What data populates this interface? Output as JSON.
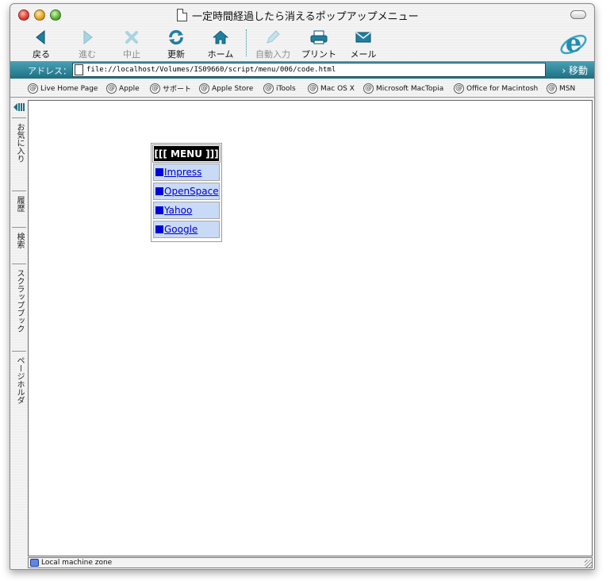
{
  "window": {
    "title": "一定時間経過したら消えるポップアップメニュー"
  },
  "toolbar": {
    "back": "戻る",
    "forward": "進む",
    "stop": "中止",
    "refresh": "更新",
    "home": "ホーム",
    "autofill": "自動入力",
    "print": "プリント",
    "mail": "メール"
  },
  "address": {
    "label": "アドレス：",
    "url": "file://localhost/Volumes/IS09660/script/menu/006/code.html",
    "go": "移動"
  },
  "favorites": [
    "Live Home Page",
    "Apple",
    "サポート",
    "Apple Store",
    "iTools",
    "Mac OS X",
    "Microsoft MacTopia",
    "Office for Macintosh",
    "MSN"
  ],
  "sidebar": {
    "tabs": [
      "お気に入り",
      "履歴",
      "検索",
      "スクラップブック",
      "ページホルダ"
    ]
  },
  "menu": {
    "header": "[[[ MENU ]]]",
    "items": [
      {
        "bullet": "■",
        "label": "Impress"
      },
      {
        "bullet": "■",
        "label": "OpenSpace"
      },
      {
        "bullet": "■",
        "label": "Yahoo"
      },
      {
        "bullet": "■",
        "label": "Google"
      }
    ]
  },
  "status": {
    "zone": "Local machine zone"
  },
  "colors": {
    "accent": "#1e6f83",
    "menu_item_bg": "#c9daf6",
    "link": "#0000cc"
  }
}
